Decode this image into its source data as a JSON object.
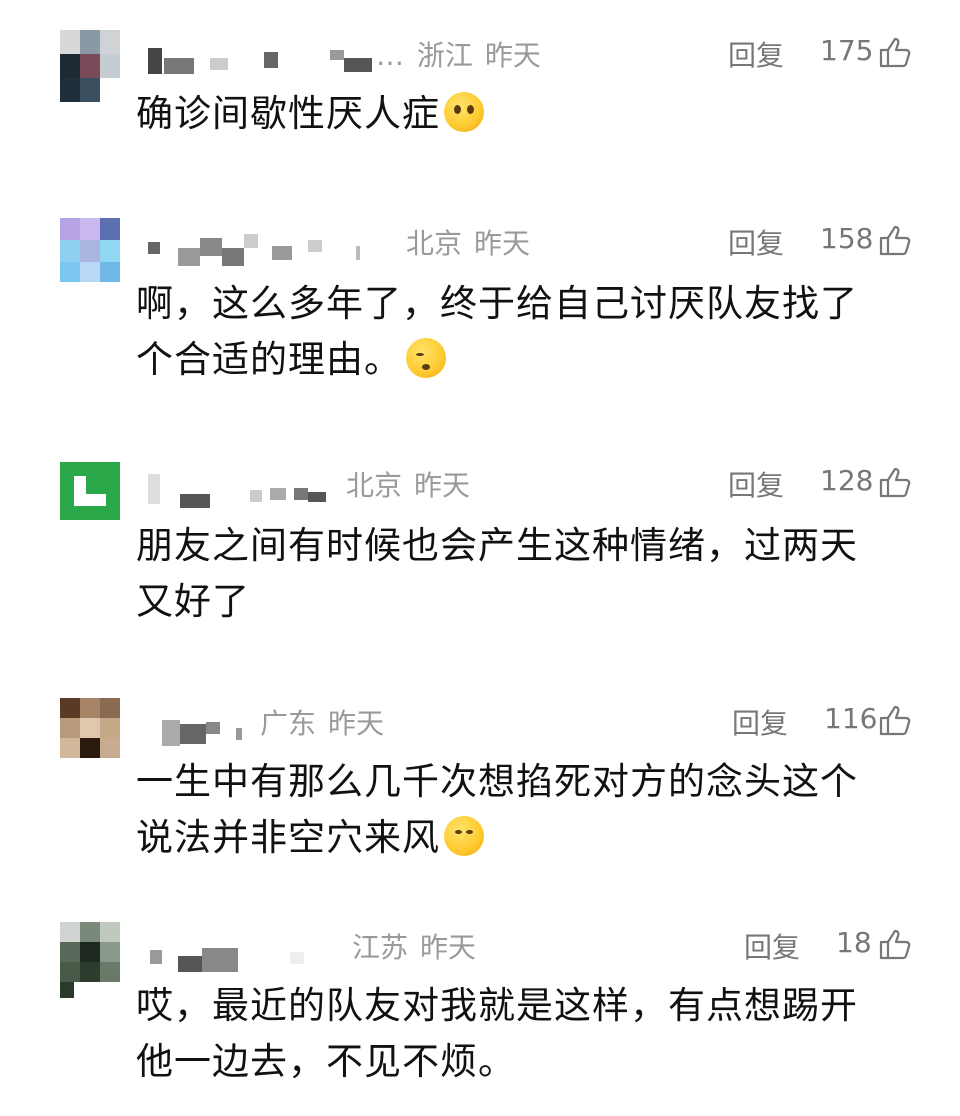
{
  "comments": [
    {
      "location": "浙江",
      "time": "昨天",
      "reply_label": "回复",
      "likes": "175",
      "text_lines": [
        "确诊间歇性厌人症"
      ],
      "emoji": "grimacing-face-emoji"
    },
    {
      "location": "北京",
      "time": "昨天",
      "reply_label": "回复",
      "likes": "158",
      "text_lines": [
        "啊，这么多年了，终于给自己讨厌队友找了",
        "个合适的理由。"
      ],
      "emoji": "shushing-face-emoji"
    },
    {
      "location": "北京",
      "time": "昨天",
      "reply_label": "回复",
      "likes": "128",
      "text_lines": [
        "朋友之间有时候也会产生这种情绪，过两天",
        "又好了"
      ],
      "emoji": ""
    },
    {
      "location": "广东",
      "time": "昨天",
      "reply_label": "回复",
      "likes": "116",
      "text_lines": [
        "一生中有那么几千次想掐死对方的念头这个",
        "说法并非空穴来风"
      ],
      "emoji": "thinking-face-emoji"
    },
    {
      "location": "江苏",
      "time": "昨天",
      "reply_label": "回复",
      "likes": "18",
      "text_lines": [
        "哎，最近的队友对我就是这样，有点想踢开",
        "他一边去，不见不烦。"
      ],
      "emoji": ""
    }
  ],
  "icons": {
    "like": "thumbs-up-outline-icon",
    "avatar_colors": [
      "#2a3a44",
      "#8fa6d8",
      "#2aa84a",
      "#6b4a30",
      "#3c4a3c"
    ]
  }
}
